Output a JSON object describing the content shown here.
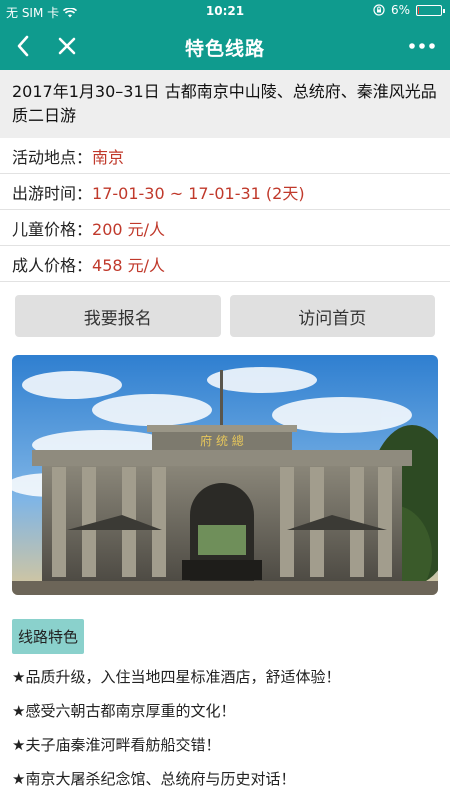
{
  "status_bar": {
    "carrier": "无 SIM 卡",
    "time": "10:21",
    "battery": "6%",
    "battery_level": 0.06
  },
  "nav": {
    "title": "特色线路",
    "back_icon": "chevron-left-icon",
    "close_icon": "close-icon",
    "more_icon": "more-dots-icon"
  },
  "trip": {
    "title": "2017年1月30–31日 古都南京中山陵、总统府、秦淮风光品质二日游",
    "info": [
      {
        "label": "活动地点：",
        "value": "南京"
      },
      {
        "label": "出游时间：",
        "value": "17-01-30 ~ 17-01-31 (2天)"
      },
      {
        "label": "儿童价格：",
        "value": "200 元/人"
      },
      {
        "label": "成人价格：",
        "value": "458 元/人"
      }
    ]
  },
  "actions": {
    "signup_label": "我要报名",
    "home_label": "访问首页"
  },
  "photo": {
    "sign_text": "府 统 總"
  },
  "features": {
    "tag": "线路特色",
    "items": [
      "★品质升级，入住当地四星标准酒店，舒适体验！",
      "★感受六朝古都南京厚重的文化！",
      "★夫子庙秦淮河畔看舫船交错！",
      "★南京大屠杀纪念馆、总统府与历史对话！"
    ]
  },
  "colors": {
    "brand": "#0f9b8e",
    "price": "#c0392b",
    "tag_bg": "#8ad1cc"
  }
}
